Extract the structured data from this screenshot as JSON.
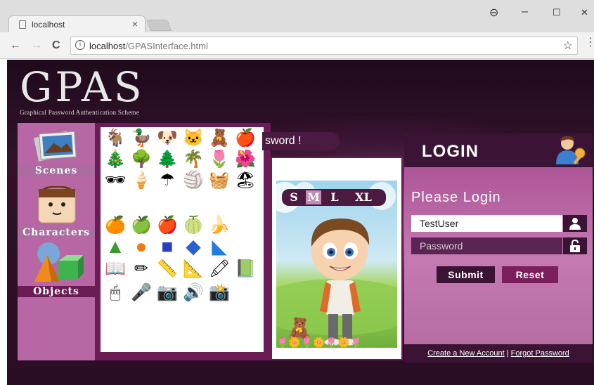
{
  "browser": {
    "tab_title": "localhost",
    "tab_close": "×",
    "url_host": "localhost",
    "url_path": "/GPASInterface.html",
    "nav_back": "←",
    "nav_forward": "→",
    "nav_reload": "C",
    "info_glyph": "i",
    "star_glyph": "☆",
    "menu_glyph": "⋮",
    "win_account": "⊖",
    "win_minimize": "–",
    "win_maximize": "☐",
    "win_close": "✕"
  },
  "logo": {
    "title": "GPAS",
    "subtitle": "Graphical Password Authentication Scheme"
  },
  "categories": [
    {
      "label": "Scenes",
      "icon": "photos-icon"
    },
    {
      "label": "Characters",
      "icon": "face-icon"
    },
    {
      "label": "Objects",
      "icon": "shapes-icon"
    }
  ],
  "palette_icons": {
    "row1": [
      "🐐",
      "🦆",
      "🐶",
      "🐱",
      "🧸",
      "🍎"
    ],
    "row2": [
      "🎄",
      "🌳",
      "🌲",
      "🌴",
      "🌷",
      "🌺"
    ],
    "row3": [
      "🕶",
      "🍦",
      "☂",
      "🏐",
      "🧺",
      "🏖"
    ],
    "row4": [
      "🍊",
      "🍏",
      "🍎",
      "🍈",
      "🍌"
    ],
    "row5": [
      "▲",
      "●",
      "■",
      "◆",
      "◣"
    ],
    "row6": [
      "📖",
      "✏",
      "📏",
      "📐",
      "🖍",
      "📗"
    ],
    "row7": [
      "🖱",
      "🎤",
      "📷",
      "🔊",
      "📸"
    ]
  },
  "canvas": {
    "title_fragment": "sword !",
    "sizes": [
      "S",
      "M",
      "L",
      "XL"
    ],
    "selected_size": "M",
    "character_glyph": "🧒",
    "teddy_glyph": "🧸",
    "flowers": "🌷🌼🌷🌼🌷🌼🌷"
  },
  "login": {
    "heading": "LOGIN",
    "please": "Please Login",
    "username_value": "TestUser",
    "password_placeholder": "Password",
    "user_glyph": "👤",
    "lock_glyph": "🔓",
    "key_glyph": "🗝",
    "submit_label": "Submit",
    "reset_label": "Reset",
    "create_account": "Create a New Account",
    "separator": "|",
    "forgot_password": "Forgot Password"
  },
  "colors": {
    "accent": "#6b1c55",
    "dark": "#3b1435",
    "category_bg": "#b768a4"
  }
}
